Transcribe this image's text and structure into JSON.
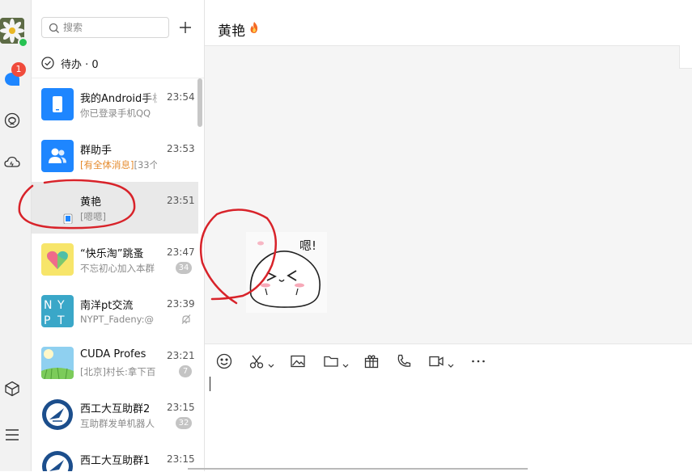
{
  "colors": {
    "accent": "#1e86ff",
    "badge_red": "#f04b3c",
    "highlight_orange": "#e58a2b",
    "annotation_red": "#d8232a"
  },
  "nav": {
    "avatar_icon": "flower-avatar-icon",
    "unread_count": "1",
    "icons": [
      "chat-bubble-icon",
      "contacts-face-icon",
      "cloud-icon",
      "cube-icon",
      "menu-icon"
    ]
  },
  "search": {
    "placeholder": "搜索"
  },
  "todo": {
    "label": "待办 · 0"
  },
  "conversations": [
    {
      "name": "我的Android手机",
      "time": "23:54",
      "preview": "你已登录手机QQ",
      "avatar_icon": "phone-device-icon"
    },
    {
      "name": "群助手",
      "time": "23:53",
      "preview_highlight": "[有全体消息]",
      "preview": "[33个",
      "avatar_icon": "group-helper-icon"
    },
    {
      "name": "黄艳",
      "time": "23:51",
      "preview": "[嗯嗯]",
      "avatar_icon": "mobile-status-icon",
      "selected": true
    },
    {
      "name": "“快乐淘”跳蚤",
      "time": "23:47",
      "preview": "不忘初心加入本群",
      "count": "34",
      "avatar_icon": "heart-logo-icon"
    },
    {
      "name": "南洋pt交流",
      "time": "23:39",
      "preview": "NYPT_Fadeny:@",
      "avatar_icon": "nypt-logo-icon",
      "muted": true
    },
    {
      "name": "CUDA Profes",
      "time": "23:21",
      "preview": "[北京]村长:拿下百",
      "count": "7",
      "avatar_icon": "sky-grass-icon"
    },
    {
      "name": "西工大互助群2",
      "time": "23:15",
      "preview": "互助群发单机器人",
      "count": "32",
      "avatar_icon": "university-seal-icon"
    },
    {
      "name": "西工大互助群1",
      "time": "23:15",
      "preview": "",
      "avatar_icon": "university-seal-icon"
    }
  ],
  "chat": {
    "title": "黄艳",
    "title_icon": "fire-icon",
    "sticker_icon": "mochi-sticker-icon",
    "sticker_text": "嗯!"
  },
  "toolbar": [
    "emoji-icon",
    "scissors-icon",
    "image-icon",
    "folder-icon",
    "gift-icon",
    "phone-call-icon",
    "video-call-icon",
    "more-icon"
  ]
}
